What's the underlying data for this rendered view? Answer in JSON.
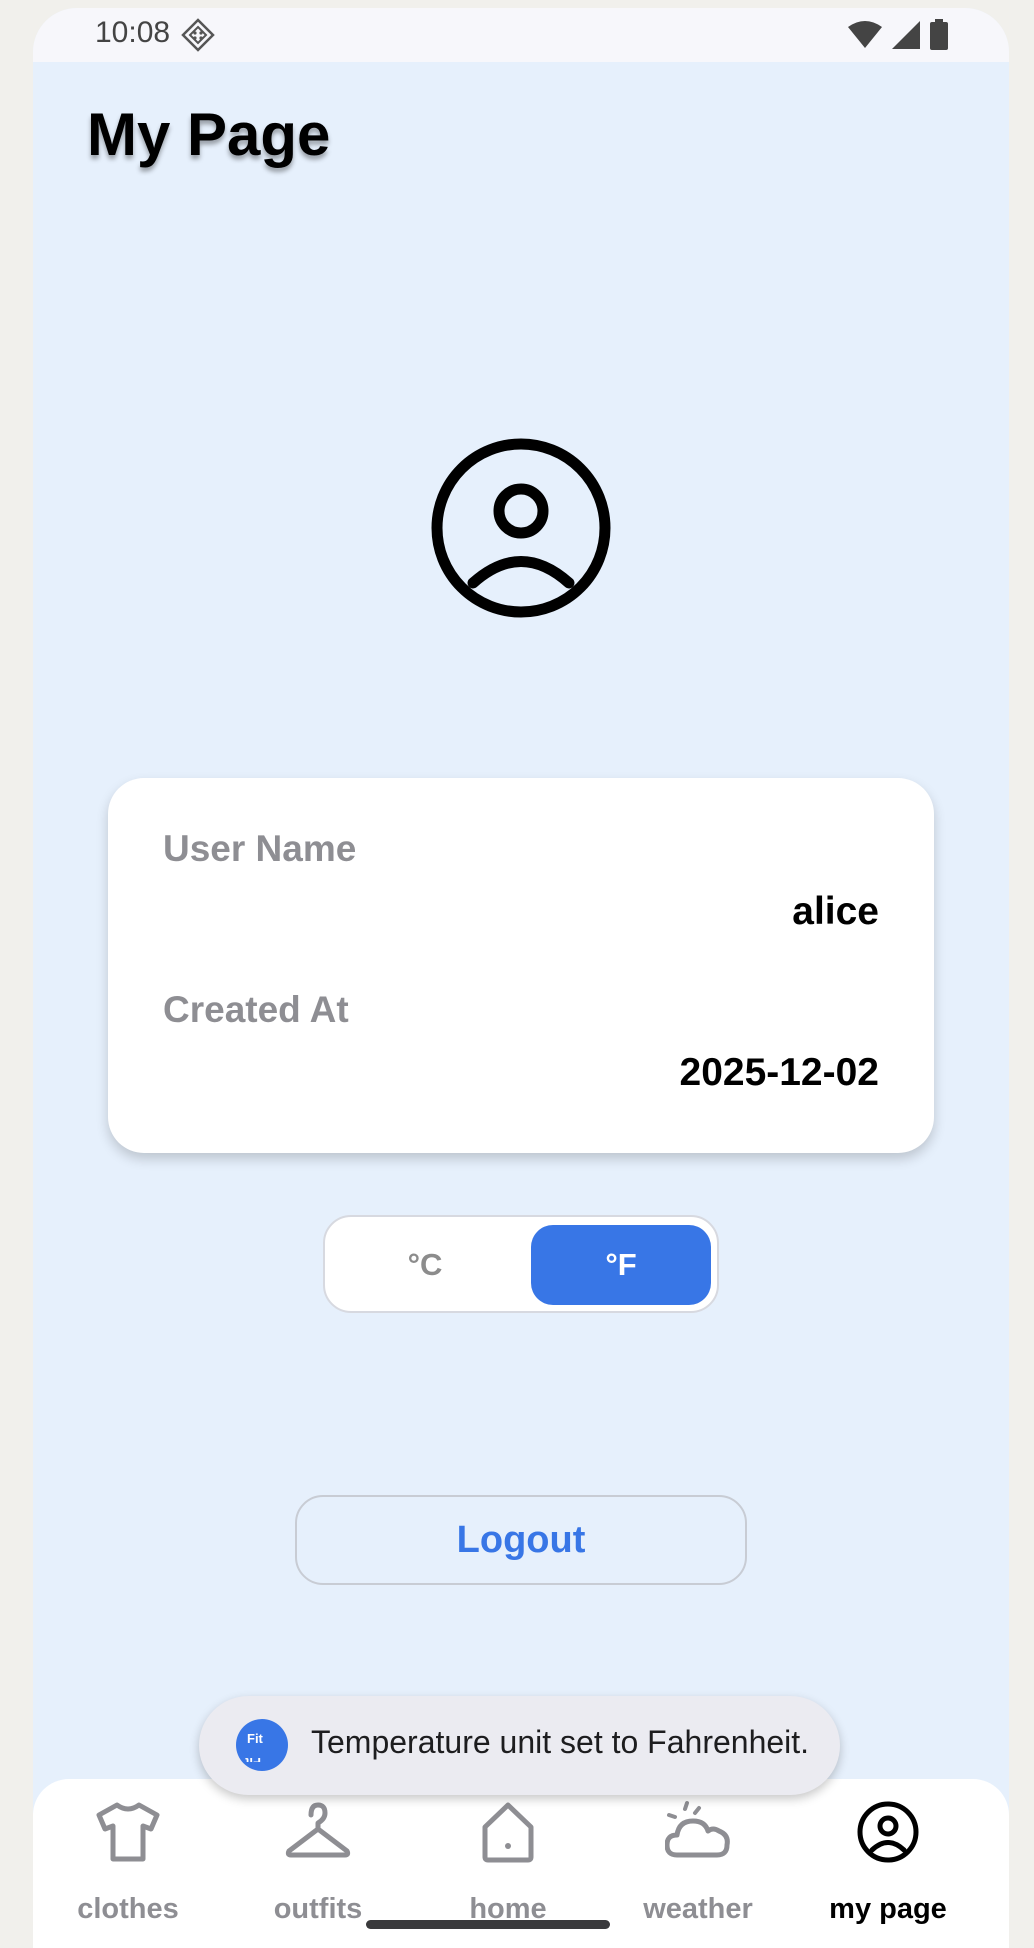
{
  "status_bar": {
    "time": "10:08"
  },
  "page": {
    "title": "My Page"
  },
  "profile": {
    "user_name_label": "User Name",
    "user_name": "alice",
    "created_at_label": "Created At",
    "created_at": "2025-12-02"
  },
  "unit_toggle": {
    "celsius_label": "°C",
    "fahrenheit_label": "°F",
    "selected": "fahrenheit"
  },
  "logout_label": "Logout",
  "toast": {
    "icon_text": "Fit",
    "message": "Temperature unit set to Fahrenheit."
  },
  "nav": {
    "items": [
      {
        "label": "clothes",
        "icon": "shirt-icon"
      },
      {
        "label": "outfits",
        "icon": "hanger-icon"
      },
      {
        "label": "home",
        "icon": "home-icon"
      },
      {
        "label": "weather",
        "icon": "cloud-sun-icon"
      },
      {
        "label": "my page",
        "icon": "account-circle-icon"
      }
    ],
    "active_index": 4
  },
  "colors": {
    "accent": "#3876e6",
    "background": "#e6f0fc"
  }
}
